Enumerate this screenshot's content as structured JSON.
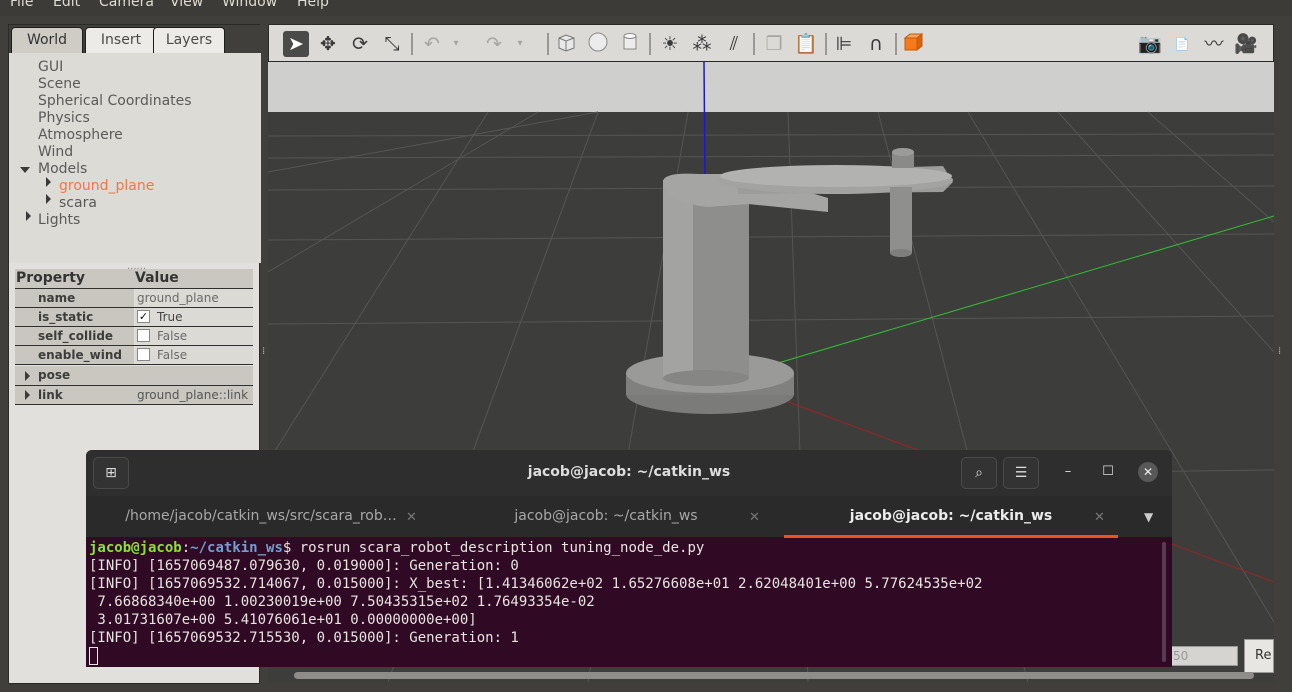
{
  "menu": [
    "File",
    "Edit",
    "Camera",
    "View",
    "Window",
    "Help"
  ],
  "left_panel": {
    "tabs": [
      "World",
      "Insert",
      "Layers"
    ],
    "active_tab": "World",
    "tree": {
      "items": [
        "GUI",
        "Scene",
        "Spherical Coordinates",
        "Physics",
        "Atmosphere",
        "Wind"
      ],
      "models_label": "Models",
      "models": [
        "ground_plane",
        "scara"
      ],
      "selected_model": "ground_plane",
      "lights_label": "Lights"
    },
    "grip": "......",
    "properties": {
      "header_property": "Property",
      "header_value": "Value",
      "rows": [
        {
          "name": "name",
          "value": "ground_plane"
        },
        {
          "name": "is_static",
          "value": "True",
          "checked": true
        },
        {
          "name": "self_collide",
          "value": "False",
          "checked": false
        },
        {
          "name": "enable_wind",
          "value": "False",
          "checked": false
        },
        {
          "name": "pose",
          "value": ""
        },
        {
          "name": "link",
          "value": "ground_plane::link"
        }
      ]
    }
  },
  "toolbar": {
    "icons": [
      "select-arrow-icon",
      "translate-icon",
      "rotate-icon",
      "scale-icon",
      "undo-icon",
      "undo-dropdown-icon",
      "redo-icon",
      "redo-dropdown-icon",
      "box-shape-icon",
      "sphere-shape-icon",
      "cylinder-shape-icon",
      "point-light-icon",
      "spot-light-icon",
      "directional-light-icon",
      "copy-icon",
      "paste-icon",
      "align-icon",
      "snap-magnet-icon",
      "change-view-icon",
      "screenshot-icon",
      "log-icon",
      "plot-icon",
      "video-record-icon"
    ]
  },
  "viewport": {
    "step_value": "50",
    "reset_label": "Re"
  },
  "terminal": {
    "title": "jacob@jacob: ~/catkin_ws",
    "tabs": [
      {
        "label": "/home/jacob/catkin_ws/src/scara_rob…"
      },
      {
        "label": "jacob@jacob: ~/catkin_ws"
      },
      {
        "label": "jacob@jacob: ~/catkin_ws"
      }
    ],
    "active_tab_index": 2,
    "prompt_user": "jacob@jacob",
    "prompt_path": "~/catkin_ws",
    "command": "$ rosrun scara_robot_description tuning_node_de.py",
    "output": [
      "[INFO] [1657069487.079630, 0.019000]: Generation: 0",
      "[INFO] [1657069532.714067, 0.015000]: X_best: [1.41346062e+02 1.65276608e+01 2.62048401e+00 5.77624535e+02",
      " 7.66868340e+00 1.00230019e+00 7.50435315e+02 1.76493354e-02",
      " 3.01731607e+00 5.41076061e+01 0.00000000e+00]",
      "[INFO] [1657069532.715530, 0.015000]: Generation: 1"
    ],
    "colors": {
      "background": "#300a24",
      "accent": "#e95420",
      "prompt_user": "#8ae234",
      "prompt_path": "#729fcf"
    }
  }
}
